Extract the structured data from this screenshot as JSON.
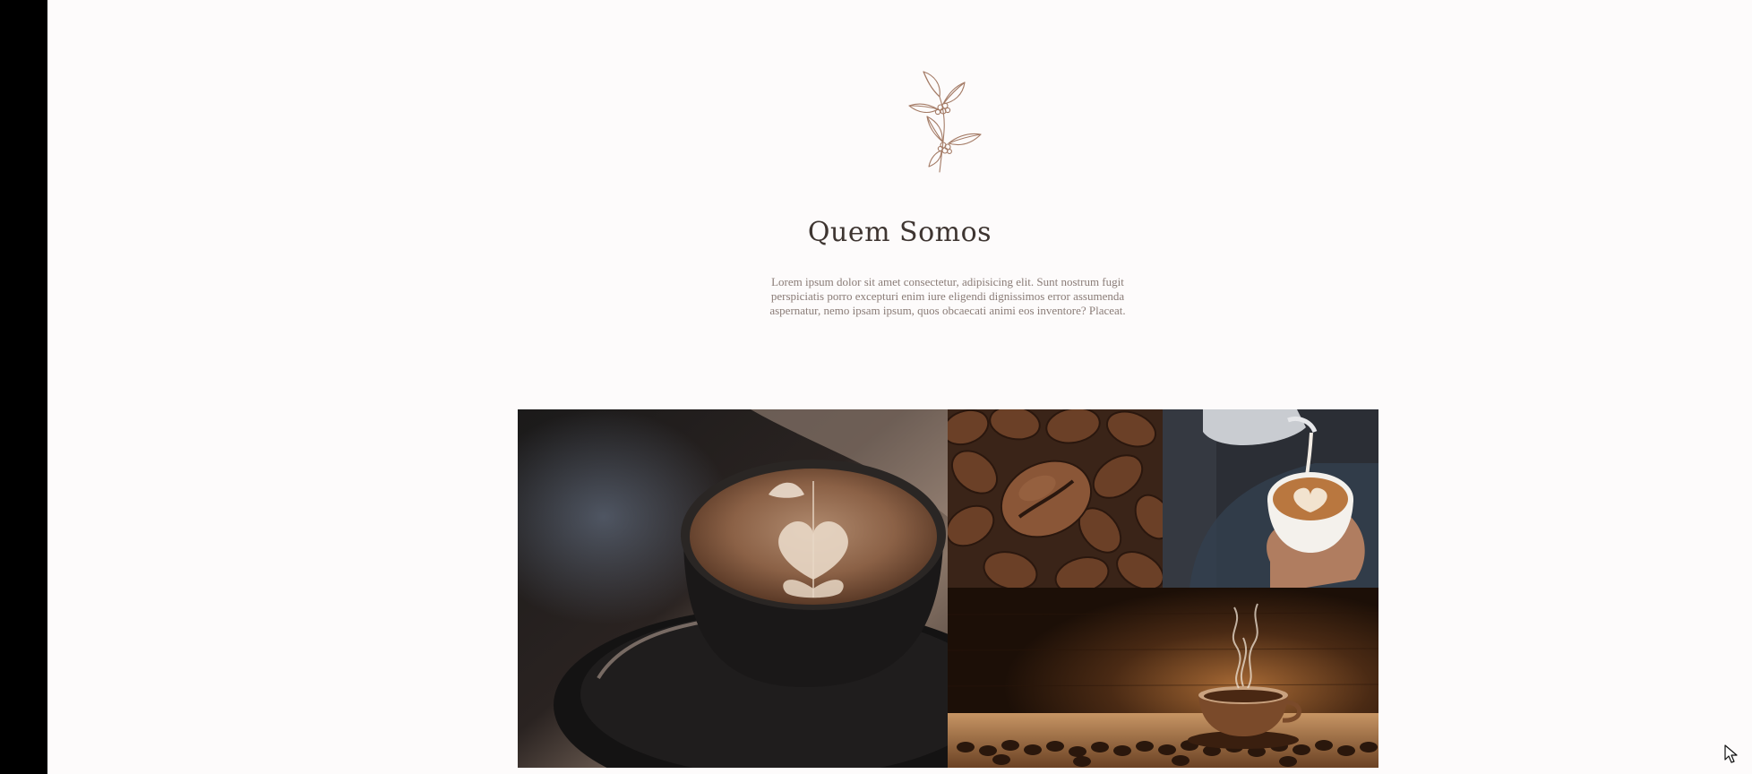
{
  "about": {
    "title": "Quem Somos",
    "text": "Lorem ipsum dolor sit amet consectetur, adipisicing elit. Sunt nostrum fugit perspiciatis porro excepturi enim iure eligendi dignissimos error assumenda aspernatur, nemo ipsam ipsum, quos obcaecati animi eos inventore? Placeat."
  },
  "colors": {
    "background": "#fdfbfb",
    "heading": "#3e3531",
    "body_text": "#8a7c77",
    "emblem_line": "#a47b66",
    "side_bar": "#000000"
  },
  "icons": {
    "emblem": "coffee-branch-icon",
    "cursor": "mouse-pointer-icon"
  },
  "gallery": {
    "photos": [
      "latte-art-cup",
      "coffee-beans",
      "milk-pour-latte",
      "steaming-cup-on-beans"
    ]
  }
}
